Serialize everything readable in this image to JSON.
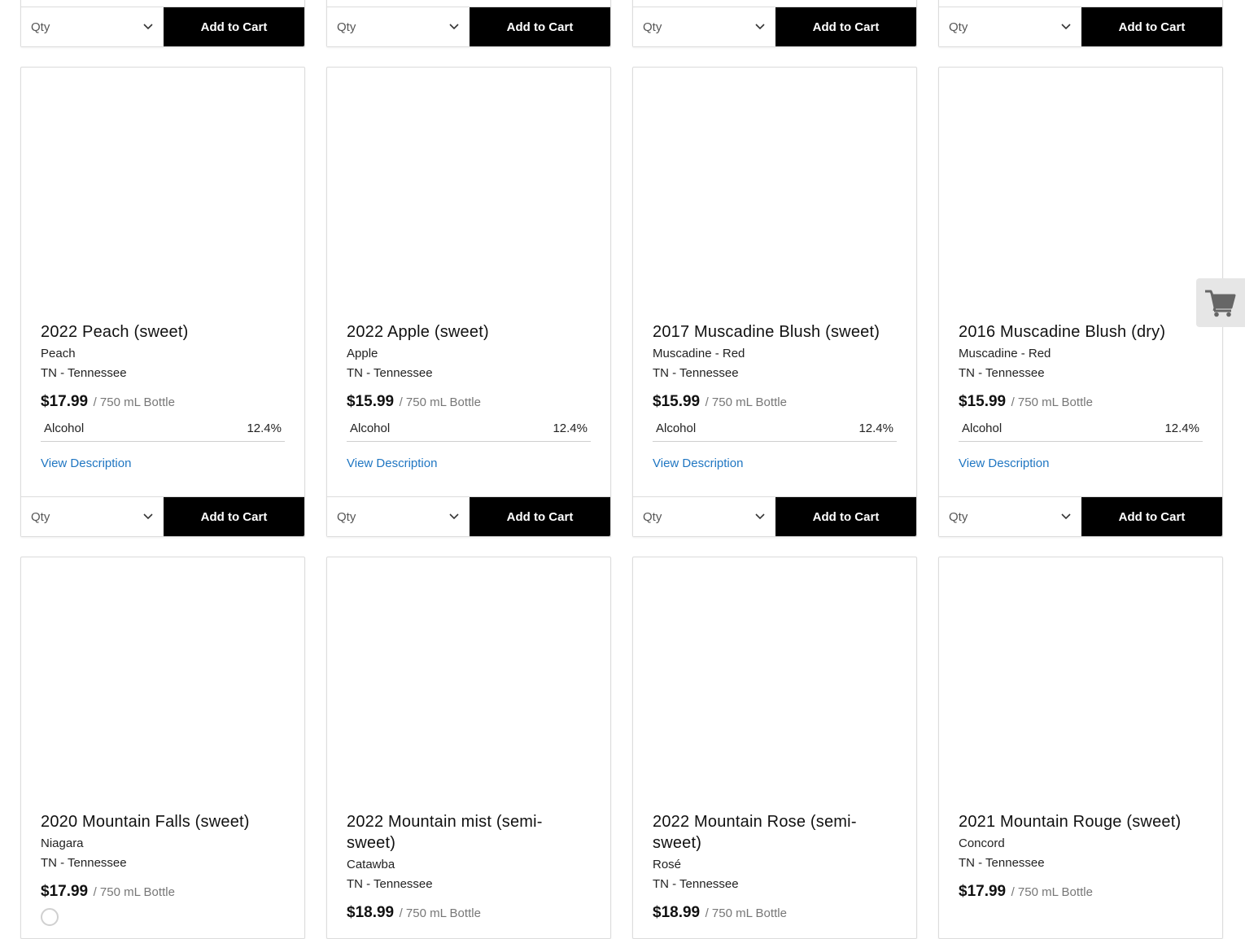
{
  "common": {
    "qty_placeholder": "Qty",
    "add_to_cart": "Add to Cart",
    "view_description": "View Description",
    "alcohol_label": "Alcohol"
  },
  "products": [
    {
      "title": "2022 Peach (sweet)",
      "varietal": "Peach",
      "region": "TN - Tennessee",
      "price": "$17.99",
      "unit": "/ 750 mL Bottle",
      "alcohol": "12.4%"
    },
    {
      "title": "2022 Apple (sweet)",
      "varietal": "Apple",
      "region": "TN - Tennessee",
      "price": "$15.99",
      "unit": "/ 750 mL Bottle",
      "alcohol": "12.4%"
    },
    {
      "title": "2017 Muscadine Blush (sweet)",
      "varietal": "Muscadine - Red",
      "region": "TN - Tennessee",
      "price": "$15.99",
      "unit": "/ 750 mL Bottle",
      "alcohol": "12.4%"
    },
    {
      "title": "2016 Muscadine Blush (dry)",
      "varietal": "Muscadine - Red",
      "region": "TN - Tennessee",
      "price": "$15.99",
      "unit": "/ 750 mL Bottle",
      "alcohol": "12.4%"
    },
    {
      "title": "2020 Mountain Falls (sweet)",
      "varietal": "Niagara",
      "region": "TN - Tennessee",
      "price": "$17.99",
      "unit": "/ 750 mL Bottle"
    },
    {
      "title": "2022 Mountain mist (semi-sweet)",
      "varietal": "Catawba",
      "region": "TN - Tennessee",
      "price": "$18.99",
      "unit": "/ 750 mL Bottle"
    },
    {
      "title": "2022 Mountain Rose (semi-sweet)",
      "varietal": "Rosé",
      "region": "TN - Tennessee",
      "price": "$18.99",
      "unit": "/ 750 mL Bottle"
    },
    {
      "title": "2021 Mountain Rouge (sweet)",
      "varietal": "Concord",
      "region": "TN - Tennessee",
      "price": "$17.99",
      "unit": "/ 750 mL Bottle"
    }
  ],
  "colors": {
    "button_bg": "#000000",
    "link": "#1f76c2",
    "cart_tab_bg": "#e6e6e6"
  },
  "icons": {
    "cart": "shopping-cart-icon",
    "qty_dropdown": "chevron-down-icon"
  }
}
